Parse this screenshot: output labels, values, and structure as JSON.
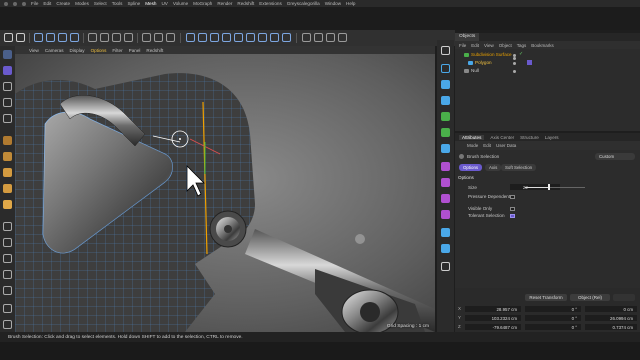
{
  "menubar": {
    "items": [
      "File",
      "Edit",
      "Create",
      "Modes",
      "Select",
      "Tools",
      "Spline",
      "Mesh",
      "UV",
      "Volume",
      "MoGraph",
      "Render",
      "Redshift",
      "Extensions",
      "Greyscalegorilla",
      "Window",
      "Help"
    ],
    "active": "Mesh"
  },
  "viewport": {
    "menu": [
      "View",
      "Cameras",
      "Display",
      "Options",
      "Filter",
      "Panel",
      "Redshift"
    ],
    "active_menu": "Options",
    "grid_spacing": "Grid Spacing : 1 cm"
  },
  "objects": {
    "tab": "Objects",
    "menu": [
      "File",
      "Edit",
      "View",
      "Object",
      "Tags",
      "Bookmarks"
    ],
    "items": [
      {
        "name": "Subdivision Surface",
        "color": "#e8a000"
      },
      {
        "name": "Polygon",
        "color": "#f0c040"
      },
      {
        "name": "Null",
        "color": "#c8c8c8"
      }
    ]
  },
  "attributes": {
    "tabs": [
      "Attributes",
      "Axis Center",
      "Structure",
      "Layers"
    ],
    "active_tab": "Attributes",
    "menu": [
      "Mode",
      "Edit",
      "User Data"
    ],
    "tool_name": "Brush Selection",
    "preset": "Custom",
    "subtabs": [
      "Options",
      "Axis",
      "Soft Selection"
    ],
    "active_subtab": "Options",
    "section": "Options",
    "size_label": "Size",
    "size_value": "22",
    "size_fraction": 0.4,
    "pressure_label": "Pressure Dependent",
    "pressure_on": false,
    "visible_only_label": "Visible Only",
    "visible_only_on": false,
    "tolerant_label": "Tolerant Selection",
    "tolerant_on": true
  },
  "coords": {
    "reset_button": "Reset Transform",
    "space": "Object (Rel)",
    "rows": [
      {
        "axis": "X",
        "pos": "28.957 cm",
        "rot": "0 °",
        "scale": "0 cm"
      },
      {
        "axis": "Y",
        "pos": "103.2324 cm",
        "rot": "0 °",
        "scale": "26.0994 cm"
      },
      {
        "axis": "Z",
        "pos": "-79.6487 cm",
        "rot": "0 °",
        "scale": "0.7374 cm"
      }
    ]
  },
  "status": {
    "text": "Brush Selection: Click and drag to select elements. Hold down SHIFT to add to the selection, CTRL to remove."
  },
  "colors": {
    "accent": "#6a5acd",
    "selection": "#f0a000",
    "polygon": "#f0c040"
  }
}
